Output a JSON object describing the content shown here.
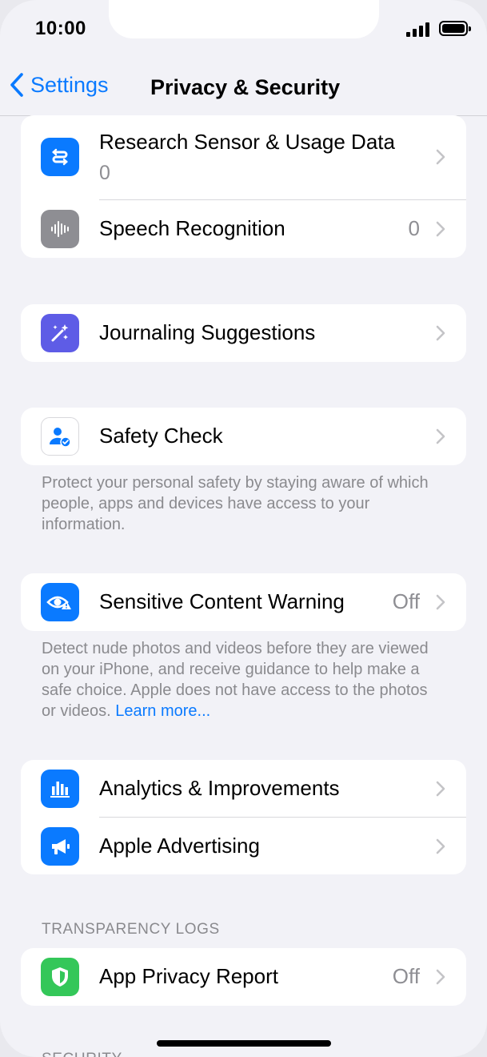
{
  "status": {
    "time": "10:00"
  },
  "nav": {
    "back_label": "Settings",
    "title": "Privacy & Security"
  },
  "groups": {
    "data": [
      {
        "label": "Research Sensor & Usage Data",
        "sub": "0",
        "icon": "research-sensor-icon",
        "color": "#0a7aff"
      },
      {
        "label": "Speech Recognition",
        "value": "0",
        "icon": "waveform-icon",
        "color": "#8e8e93"
      }
    ],
    "journaling": {
      "label": "Journaling Suggestions",
      "icon": "sparkle-wand-icon",
      "color": "#5e5ce6"
    },
    "safety": {
      "label": "Safety Check",
      "icon": "person-check-icon",
      "footer": "Protect your personal safety by staying aware of which people, apps and devices have access to your information."
    },
    "sensitive": {
      "label": "Sensitive Content Warning",
      "value": "Off",
      "icon": "eye-warning-icon",
      "color": "#0a7aff",
      "footer": "Detect nude photos and videos before they are viewed on your iPhone, and receive guidance to help make a safe choice. Apple does not have access to the photos or videos.",
      "link": "Learn more..."
    },
    "analytics": [
      {
        "label": "Analytics & Improvements",
        "icon": "bar-chart-icon",
        "color": "#0a7aff"
      },
      {
        "label": "Apple Advertising",
        "icon": "megaphone-icon",
        "color": "#0a7aff"
      }
    ],
    "transparency": {
      "header": "TRANSPARENCY LOGS",
      "label": "App Privacy Report",
      "value": "Off",
      "icon": "shield-icon",
      "color": "#34c759"
    },
    "security_header": "SECURITY"
  }
}
